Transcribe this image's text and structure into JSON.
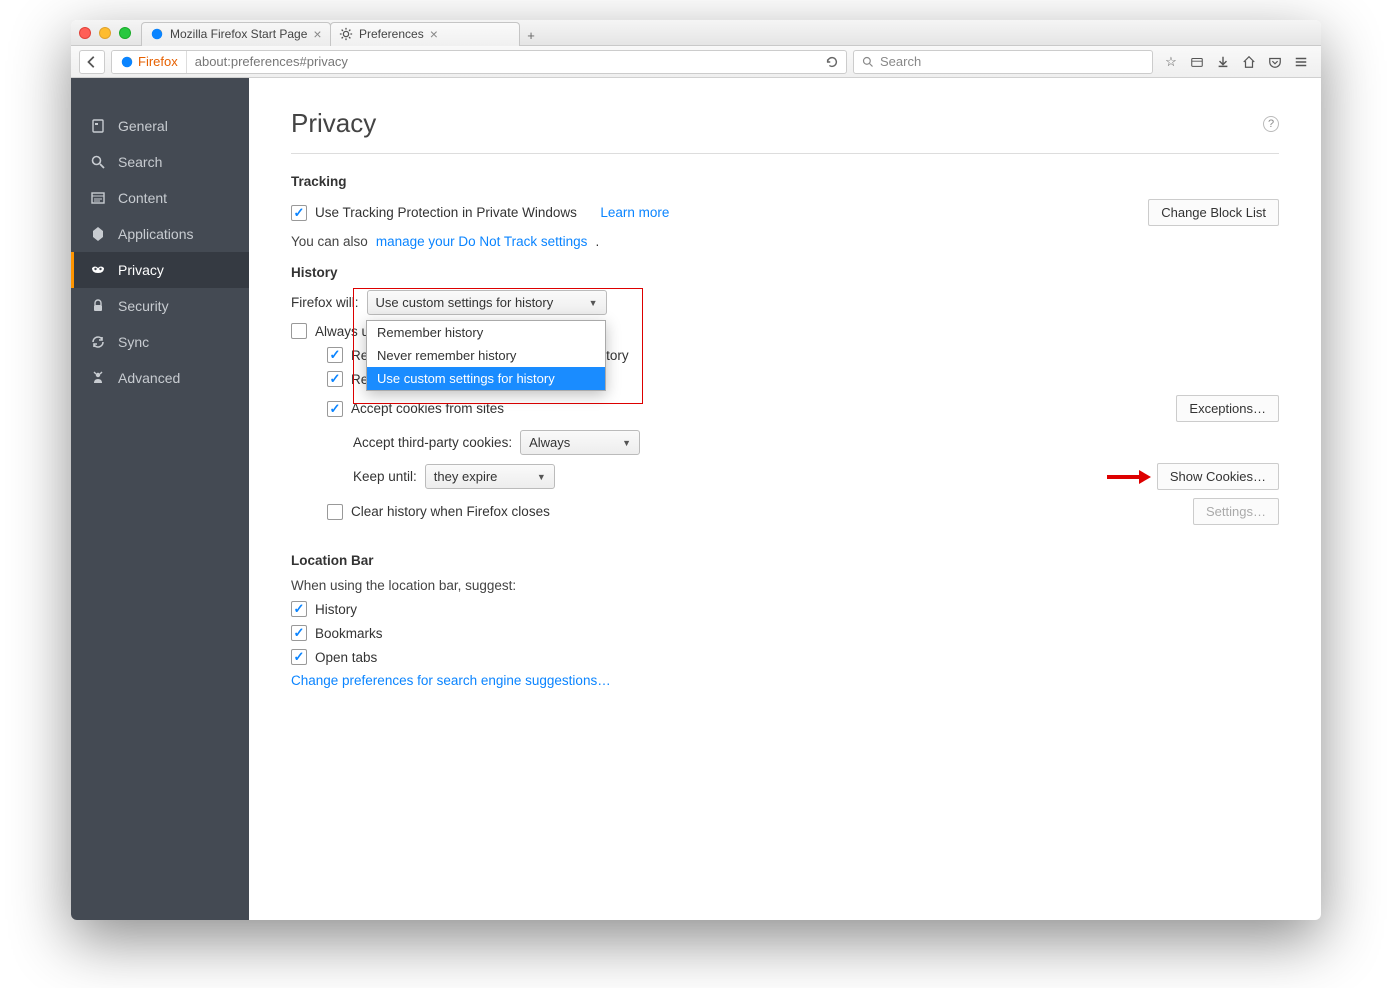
{
  "window": {
    "tabs": [
      {
        "title": "Mozilla Firefox Start Page"
      },
      {
        "title": "Preferences"
      }
    ]
  },
  "toolbar": {
    "identity": "Firefox",
    "url": "about:preferences#privacy",
    "search_placeholder": "Search"
  },
  "sidebar": {
    "items": [
      {
        "label": "General"
      },
      {
        "label": "Search"
      },
      {
        "label": "Content"
      },
      {
        "label": "Applications"
      },
      {
        "label": "Privacy"
      },
      {
        "label": "Security"
      },
      {
        "label": "Sync"
      },
      {
        "label": "Advanced"
      }
    ]
  },
  "page": {
    "title": "Privacy",
    "tracking": {
      "heading": "Tracking",
      "use_tp_label": "Use Tracking Protection in Private Windows",
      "learn_more": "Learn more",
      "change_block_list": "Change Block List",
      "also_text": "You can also ",
      "dnt_link": "manage your Do Not Track settings",
      "period": "."
    },
    "history": {
      "heading": "History",
      "firefox_will": "Firefox will:",
      "select_value": "Use custom settings for history",
      "options": [
        "Remember history",
        "Never remember history",
        "Use custom settings for history"
      ],
      "always_private": "Always use private browsing mode",
      "remember_browsing": "Remember my browsing and download history",
      "remember_search": "Remember search and form history",
      "accept_cookies": "Accept cookies from sites",
      "exceptions": "Exceptions…",
      "third_party_label": "Accept third-party cookies:",
      "third_party_value": "Always",
      "keep_until_label": "Keep until:",
      "keep_until_value": "they expire",
      "show_cookies": "Show Cookies…",
      "clear_on_close": "Clear history when Firefox closes",
      "settings": "Settings…"
    },
    "location_bar": {
      "heading": "Location Bar",
      "intro": "When using the location bar, suggest:",
      "history": "History",
      "bookmarks": "Bookmarks",
      "open_tabs": "Open tabs",
      "change_prefs": "Change preferences for search engine suggestions…"
    }
  }
}
